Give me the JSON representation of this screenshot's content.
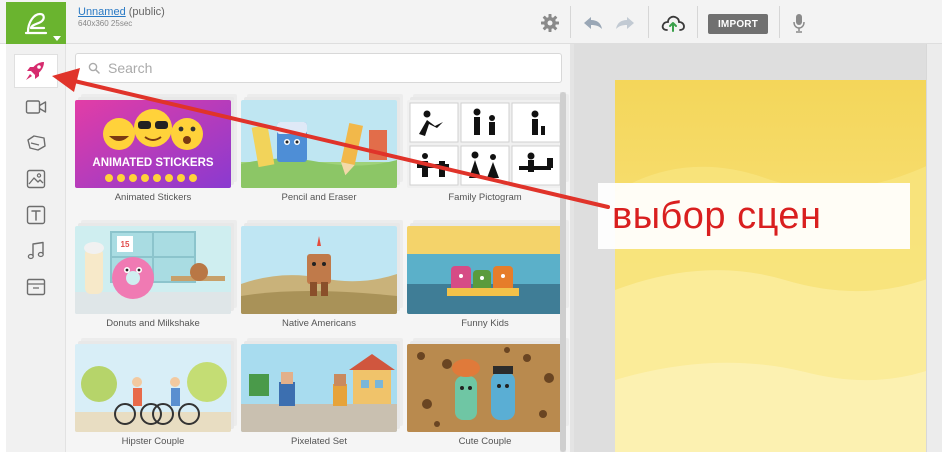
{
  "project": {
    "name": "Unnamed",
    "visibility": "(public)",
    "meta": "640x360 25sec"
  },
  "toolbar": {
    "import_label": "IMPORT"
  },
  "search": {
    "placeholder": "Search"
  },
  "library": {
    "items": [
      {
        "label": "Animated Stickers",
        "thumb_text": "ANIMATED STICKERS"
      },
      {
        "label": "Pencil and Eraser"
      },
      {
        "label": "Family Pictogram"
      },
      {
        "label": "Donuts and Milkshake",
        "thumb_text": "15"
      },
      {
        "label": "Native Americans"
      },
      {
        "label": "Funny Kids"
      },
      {
        "label": "Hipster Couple"
      },
      {
        "label": "Pixelated Set"
      },
      {
        "label": "Cute Couple"
      }
    ]
  },
  "annotation": {
    "text": "выбор сцен",
    "color": "#d91f1f"
  },
  "icons": {
    "logo": "logo-icon",
    "scenes_tool": "rocket-icon",
    "settings": "gear-icon",
    "undo": "undo-icon",
    "redo": "redo-icon",
    "upload": "upload-cloud-icon",
    "mic": "microphone-icon"
  },
  "colors": {
    "brand_green": "#6ab42f",
    "active_tool": "#d62b6e",
    "canvas_yellow": "#f6df6a",
    "link_blue": "#2a7ac5"
  }
}
